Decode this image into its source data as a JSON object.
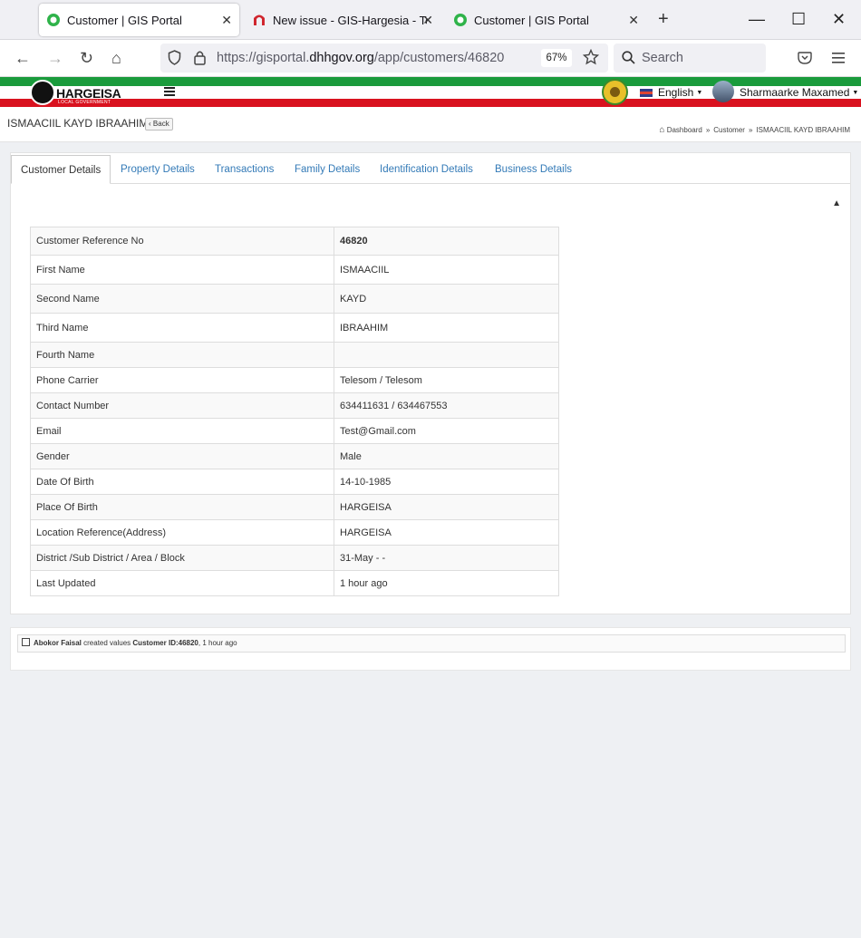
{
  "browser": {
    "tabs": [
      {
        "title": "Customer | GIS Portal",
        "active": true
      },
      {
        "title": "New issue - GIS-Hargesia - Team",
        "active": false
      },
      {
        "title": "Customer | GIS Portal",
        "active": false
      }
    ],
    "url_prefix": "https://gisportal.",
    "url_domain": "dhhgov.org",
    "url_path": "/app/customers/46820",
    "zoom": "67%",
    "search_placeholder": "Search"
  },
  "header": {
    "logo_text": "HARGEISA",
    "logo_subtext": "LOCAL GOVERNMENT",
    "language": "English",
    "user_name": "Sharmaarke Maxamed"
  },
  "page": {
    "title": "ISMAACIIL KAYD IBRAAHIM",
    "back_label": "Back",
    "breadcrumb": [
      "Dashboard",
      "Customer",
      "ISMAACIIL KAYD IBRAAHIM"
    ]
  },
  "tabs": [
    "Customer Details",
    "Property Details",
    "Transactions",
    "Family Details",
    "Identification Details",
    "Business Details"
  ],
  "customer": {
    "rows": [
      {
        "label": "Customer Reference No",
        "value": "46820"
      },
      {
        "label": "First Name",
        "value": "ISMAACIIL"
      },
      {
        "label": "Second Name",
        "value": "KAYD"
      },
      {
        "label": "Third Name",
        "value": "IBRAAHIM"
      },
      {
        "label": "Fourth Name",
        "value": ""
      },
      {
        "label": "Phone Carrier",
        "value": "Telesom / Telesom"
      },
      {
        "label": "Contact Number",
        "value": "634411631 / 634467553"
      },
      {
        "label": "Email",
        "value": "Test@Gmail.com"
      },
      {
        "label": "Gender",
        "value": "Male"
      },
      {
        "label": "Date Of Birth",
        "value": "14-10-1985"
      },
      {
        "label": "Place Of Birth",
        "value": "HARGEISA"
      },
      {
        "label": "Location Reference(Address)",
        "value": "HARGEISA"
      },
      {
        "label": "District /Sub District / Area / Block",
        "value": "31-May - -"
      },
      {
        "label": "Last Updated",
        "value": "1 hour ago"
      }
    ]
  },
  "activity": {
    "user": "Abokor Faisal",
    "action": "created values",
    "target": "Customer ID:46820",
    "time": ", 1 hour ago"
  }
}
